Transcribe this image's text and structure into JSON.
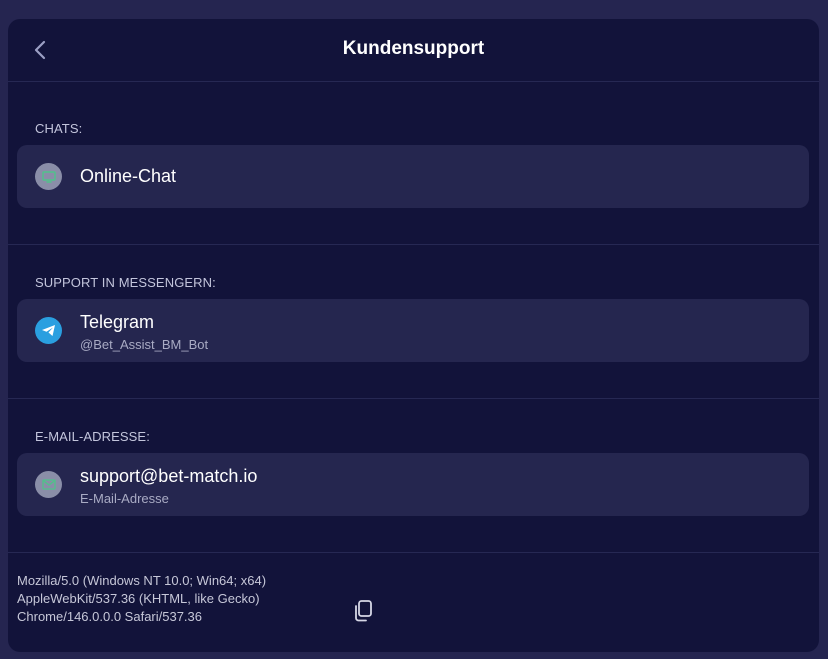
{
  "header": {
    "title": "Kundensupport",
    "back_icon": "chevron-left-icon"
  },
  "sections": {
    "chats": {
      "label": "CHATS:",
      "item": {
        "title": "Online-Chat",
        "icon": "chat-monitor-icon"
      }
    },
    "messenger": {
      "label": "SUPPORT IN MESSENGERN:",
      "item": {
        "title": "Telegram",
        "subtitle": "@Bet_Assist_BM_Bot",
        "icon": "telegram-icon"
      }
    },
    "email": {
      "label": "E-MAIL-ADRESSE:",
      "item": {
        "title": "support@bet-match.io",
        "subtitle": "E-Mail-Adresse",
        "icon": "envelope-icon"
      }
    }
  },
  "footer": {
    "user_agent_lines": [
      "Mozilla/5.0 (Windows NT 10.0; Win64; x64)",
      "AppleWebKit/537.36 (KHTML, like Gecko)",
      "Chrome/146.0.0.0 Safari/537.36"
    ],
    "copy_icon": "copy-icon"
  },
  "colors": {
    "page_bg": "#252550",
    "panel_bg": "#12133a",
    "card_bg": "#25264f",
    "telegram": "#2a9fe0",
    "icon_green": "#4fc38a"
  }
}
